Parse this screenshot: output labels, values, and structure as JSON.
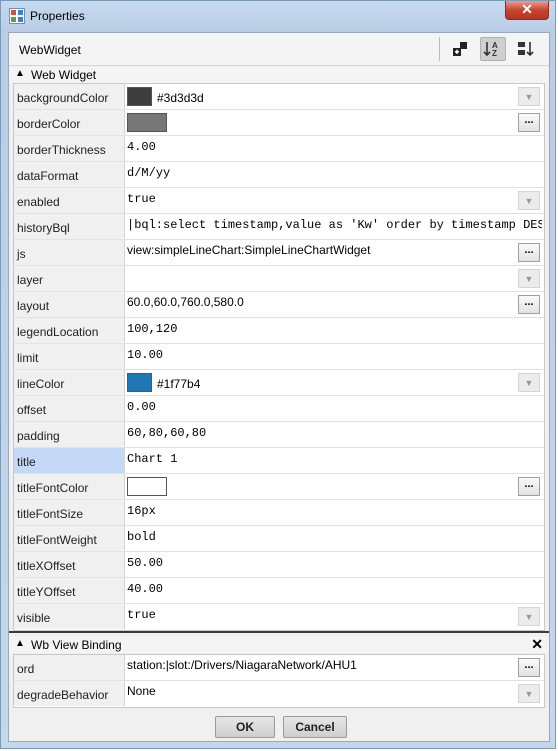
{
  "window": {
    "title": "Properties",
    "close_symbol": "✕"
  },
  "header": {
    "title": "WebWidget"
  },
  "sections": {
    "web_widget": {
      "label": "Web Widget"
    },
    "binding": {
      "label": "Wb View Binding",
      "close_symbol": "✕"
    }
  },
  "properties": {
    "backgroundColor": {
      "name": "backgroundColor",
      "value": "#3d3d3d",
      "swatch": "#3d3d3d"
    },
    "borderColor": {
      "name": "borderColor",
      "swatch": "#777777"
    },
    "borderThickness": {
      "name": "borderThickness",
      "value": "4.00"
    },
    "dataFormat": {
      "name": "dataFormat",
      "value": "d/M/yy"
    },
    "enabled": {
      "name": "enabled",
      "value": "true"
    },
    "historyBql": {
      "name": "historyBql",
      "value": "|bql:select timestamp,value as 'Kw' order by timestamp DESC"
    },
    "js": {
      "name": "js",
      "value": "view:simpleLineChart:SimpleLineChartWidget"
    },
    "layer": {
      "name": "layer",
      "value": ""
    },
    "layout": {
      "name": "layout",
      "value": "60.0,60.0,760.0,580.0"
    },
    "legendLocation": {
      "name": "legendLocation",
      "value": "100,120"
    },
    "limit": {
      "name": "limit",
      "value": "10.00"
    },
    "lineColor": {
      "name": "lineColor",
      "value": "#1f77b4",
      "swatch": "#1f77b4"
    },
    "offset": {
      "name": "offset",
      "value": "0.00"
    },
    "padding": {
      "name": "padding",
      "value": "60,80,60,80"
    },
    "title": {
      "name": "title",
      "value": "Chart 1"
    },
    "titleFontColor": {
      "name": "titleFontColor",
      "swatch": "#ffffff"
    },
    "titleFontSize": {
      "name": "titleFontSize",
      "value": "16px"
    },
    "titleFontWeight": {
      "name": "titleFontWeight",
      "value": "bold"
    },
    "titleXOffset": {
      "name": "titleXOffset",
      "value": "50.00"
    },
    "titleYOffset": {
      "name": "titleYOffset",
      "value": "40.00"
    },
    "visible": {
      "name": "visible",
      "value": "true"
    }
  },
  "binding": {
    "ord": {
      "name": "ord",
      "value": "station:|slot:/Drivers/NiagaraNetwork/AHU1"
    },
    "degradeBehavior": {
      "name": "degradeBehavior",
      "value": "None"
    }
  },
  "controls": {
    "dropdown_glyph": "▼",
    "ellipsis": "...",
    "collapse_glyph": "▲"
  },
  "buttons": {
    "ok": "OK",
    "cancel": "Cancel"
  }
}
